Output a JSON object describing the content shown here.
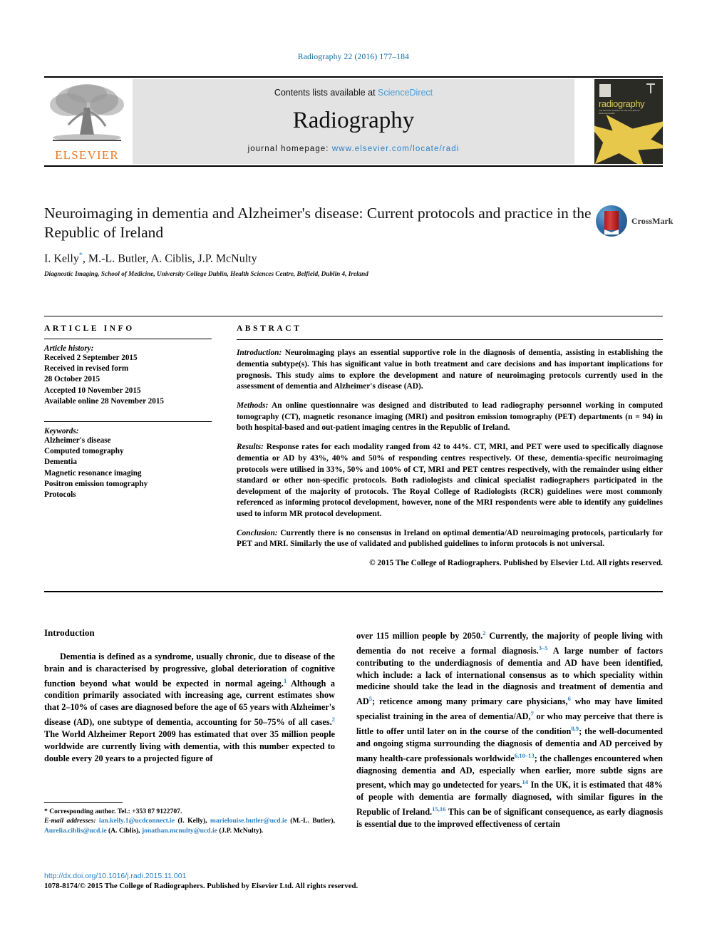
{
  "running_head": "Radiography 22 (2016) 177–184",
  "masthead": {
    "contents_prefix": "Contents lists available at ",
    "sciencedirect": "ScienceDirect",
    "journal_name": "Radiography",
    "homepage_prefix": "journal homepage: ",
    "homepage_url": "www.elsevier.com/locate/radi",
    "publisher_wordmark": "ELSEVIER",
    "cover_title": "radiography",
    "cover_subtitle": "THE OFFICIAL JOURNAL OF THE COLLEGE OF RADIOGRAPHERS"
  },
  "article": {
    "title": "Neuroimaging in dementia and Alzheimer's disease: Current protocols and practice in the Republic of Ireland",
    "authors": "I. Kelly",
    "authors_rest": ", M.-L. Butler, A. Ciblis, J.P. McNulty",
    "author_marker": "*",
    "affiliation": "Diagnostic Imaging, School of Medicine, University College Dublin, Health Sciences Centre, Belfield, Dublin 4, Ireland",
    "crossmark_label": "CrossMark"
  },
  "article_info": {
    "heading": "ARTICLE INFO",
    "history_label": "Article history:",
    "history": [
      "Received 2 September 2015",
      "Received in revised form",
      "28 October 2015",
      "Accepted 10 November 2015",
      "Available online 28 November 2015"
    ],
    "keywords_label": "Keywords:",
    "keywords": [
      "Alzheimer's disease",
      "Computed tomography",
      "Dementia",
      "Magnetic resonance imaging",
      "Positron emission tomography",
      "Protocols"
    ]
  },
  "abstract": {
    "heading": "ABSTRACT",
    "introduction_label": "Introduction:",
    "introduction": "Neuroimaging plays an essential supportive role in the diagnosis of dementia, assisting in establishing the dementia subtype(s). This has significant value in both treatment and care decisions and has important implications for prognosis. This study aims to explore the development and nature of neuroimaging protocols currently used in the assessment of dementia and Alzheimer's disease (AD).",
    "methods_label": "Methods:",
    "methods": "An online questionnaire was designed and distributed to lead radiography personnel working in computed tomography (CT), magnetic resonance imaging (MRI) and positron emission tomography (PET) departments (n = 94) in both hospital-based and out-patient imaging centres in the Republic of Ireland.",
    "results_label": "Results:",
    "results": "Response rates for each modality ranged from 42 to 44%. CT, MRI, and PET were used to specifically diagnose dementia or AD by 43%, 40% and 50% of responding centres respectively. Of these, dementia-specific neuroimaging protocols were utilised in 33%, 50% and 100% of CT, MRI and PET centres respectively, with the remainder using either standard or other non-specific protocols. Both radiologists and clinical specialist radiographers participated in the development of the majority of protocols. The Royal College of Radiologists (RCR) guidelines were most commonly referenced as informing protocol development, however, none of the MRI respondents were able to identify any guidelines used to inform MR protocol development.",
    "conclusion_label": "Conclusion:",
    "conclusion": "Currently there is no consensus in Ireland on optimal dementia/AD neuroimaging protocols, particularly for PET and MRI. Similarly the use of validated and published guidelines to inform protocols is not universal.",
    "copyright": "© 2015 The College of Radiographers. Published by Elsevier Ltd. All rights reserved."
  },
  "body": {
    "section_heading": "Introduction",
    "left_para_1": "Dementia is defined as a syndrome, usually chronic, due to disease of the brain and is characterised by progressive, global deterioration of cognitive function beyond what would be expected in normal ageing.",
    "left_ref_1": "1",
    "left_para_2": " Although a condition primarily associated with increasing age, current estimates show that 2–10% of cases are diagnosed before the age of 65 years with Alzheimer's disease (AD), one subtype of dementia, accounting for 50–75% of all cases.",
    "left_ref_2": "2",
    "left_para_3": " The World Alzheimer Report 2009 has estimated that over 35 million people worldwide are currently living with dementia, with this number expected to double every 20 years to a projected figure of",
    "right_para_1": "over 115 million people by 2050.",
    "right_ref_1": "2",
    "right_para_2": " Currently, the majority of people living with dementia do not receive a formal diagnosis.",
    "right_ref_2": "3–5",
    "right_para_3": " A large number of factors contributing to the underdiagnosis of dementia and AD have been identified, which include: a lack of international consensus as to which speciality within medicine should take the lead in the diagnosis and treatment of dementia and AD",
    "right_ref_3": "5",
    "right_para_4": "; reticence among many primary care physicians,",
    "right_ref_4": "6",
    "right_para_5": " who may have limited specialist training in the area of dementia/AD,",
    "right_ref_5": "7",
    "right_para_6": " or who may perceive that there is little to offer until later on in the course of the condition",
    "right_ref_6": "8,9",
    "right_para_7": "; the well-documented and ongoing stigma surrounding the diagnosis of dementia and AD perceived by many health-care professionals worldwide",
    "right_ref_7": "6,10–13",
    "right_para_8": "; the challenges encountered when diagnosing dementia and AD, especially when earlier, more subtle signs are present, which may go undetected for years.",
    "right_ref_8": "14",
    "right_para_9": " In the UK, it is estimated that 48% of people with dementia are formally diagnosed, with similar figures in the Republic of Ireland.",
    "right_ref_9": "15,16",
    "right_para_10": " This can be of significant consequence, as early diagnosis is essential due to the improved effectiveness of certain"
  },
  "footnote": {
    "corresponding": "Corresponding author. Tel.: +353 87 9122707.",
    "email_label": "E-mail addresses:",
    "emails": [
      {
        "address": "ian.kelly.1@ucdconnect.ie",
        "name": "(I. Kelly)"
      },
      {
        "address": "marielouise.butler@ucd.ie",
        "name": "(M.-L. Butler)"
      },
      {
        "address": "Aurelia.ciblis@ucd.ie",
        "name": "(A. Ciblis)"
      },
      {
        "address": "jonathan.mcnulty@ucd.ie",
        "name": "(J.P. McNulty)"
      }
    ]
  },
  "footer": {
    "doi": "http://dx.doi.org/10.1016/j.radi.2015.11.001",
    "issn_line": "1078-8174/© 2015 The College of Radiographers. Published by Elsevier Ltd. All rights reserved."
  },
  "colors": {
    "link": "#2b7fc4",
    "running_head": "#0b6ba4",
    "elsevier_orange": "#e87722",
    "cover_gold": "#e8c84b"
  }
}
